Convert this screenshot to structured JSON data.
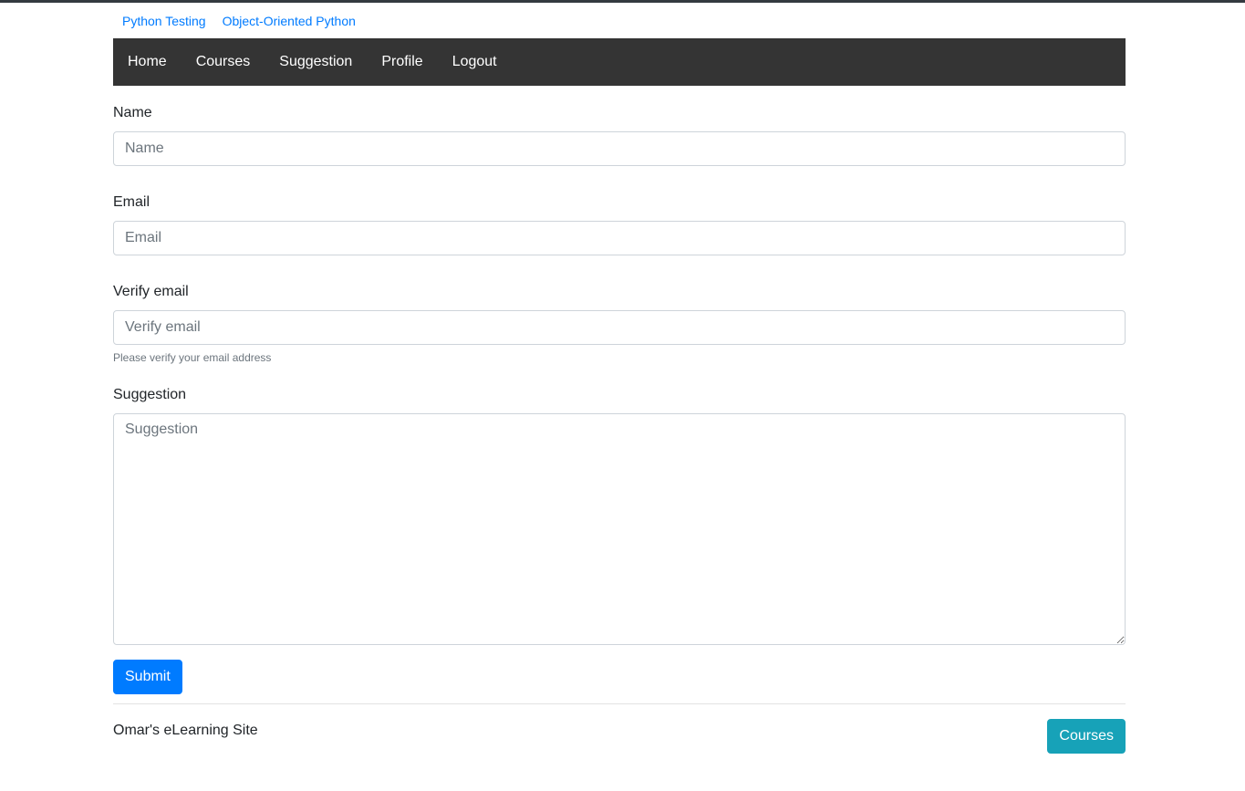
{
  "top_links": [
    "Python Testing",
    "Object-Oriented Python"
  ],
  "nav": [
    "Home",
    "Courses",
    "Suggestion",
    "Profile",
    "Logout"
  ],
  "form": {
    "name_label": "Name",
    "name_placeholder": "Name",
    "email_label": "Email",
    "email_placeholder": "Email",
    "verify_label": "Verify email",
    "verify_placeholder": "Verify email",
    "verify_help": "Please verify your email address",
    "suggestion_label": "Suggestion",
    "suggestion_placeholder": "Suggestion",
    "submit_label": "Submit"
  },
  "footer": {
    "site_name": "Omar's eLearning Site",
    "courses_button": "Courses"
  },
  "colors": {
    "navbar": "#343434",
    "link": "#007bff",
    "primary": "#007bff",
    "info": "#17a2b8"
  }
}
